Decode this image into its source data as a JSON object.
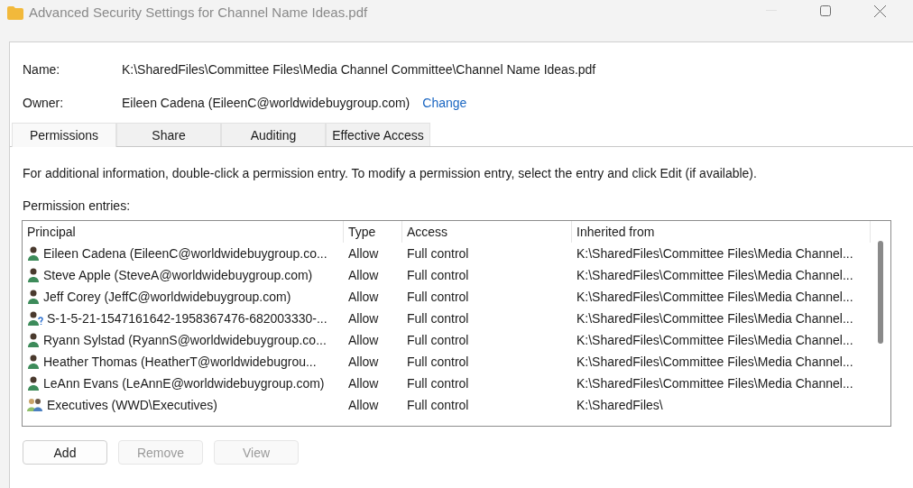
{
  "window": {
    "title": "Advanced Security Settings for Channel Name Ideas.pdf"
  },
  "fields": [
    {
      "label": "Name:",
      "value": "K:\\SharedFiles\\Committee Files\\Media Channel Committee\\Channel Name Ideas.pdf"
    },
    {
      "label": "Owner:",
      "value": "Eileen Cadena (EileenC@worldwidebuygroup.com)",
      "link": "Change"
    }
  ],
  "tabs": [
    {
      "label": "Permissions",
      "selected": true
    },
    {
      "label": "Share",
      "selected": false
    },
    {
      "label": "Auditing",
      "selected": false
    },
    {
      "label": "Effective Access",
      "selected": false
    }
  ],
  "info": "For additional information, double-click a permission entry. To modify a permission entry, select the entry and click Edit (if available).",
  "entries_label": "Permission entries:",
  "table": {
    "columns": [
      "Principal",
      "Type",
      "Access",
      "Inherited from"
    ],
    "rows": [
      {
        "kind": "user",
        "principal": "Eileen Cadena (EileenC@worldwidebuygroup.co...",
        "type": "Allow",
        "access": "Full control",
        "inherited": "K:\\SharedFiles\\Committee Files\\Media Channel..."
      },
      {
        "kind": "user",
        "principal": "Steve Apple (SteveA@worldwidebuygroup.com)",
        "type": "Allow",
        "access": "Full control",
        "inherited": "K:\\SharedFiles\\Committee Files\\Media Channel..."
      },
      {
        "kind": "user",
        "principal": "Jeff Corey (JeffC@worldwidebuygroup.com)",
        "type": "Allow",
        "access": "Full control",
        "inherited": "K:\\SharedFiles\\Committee Files\\Media Channel..."
      },
      {
        "kind": "unknown",
        "principal": "S-1-5-21-1547161642-1958367476-682003330-...",
        "type": "Allow",
        "access": "Full control",
        "inherited": "K:\\SharedFiles\\Committee Files\\Media Channel..."
      },
      {
        "kind": "user",
        "principal": "Ryann Sylstad (RyannS@worldwidebuygroup.co...",
        "type": "Allow",
        "access": "Full control",
        "inherited": "K:\\SharedFiles\\Committee Files\\Media Channel..."
      },
      {
        "kind": "user",
        "principal": "Heather Thomas (HeatherT@worldwidebugrou...",
        "type": "Allow",
        "access": "Full control",
        "inherited": "K:\\SharedFiles\\Committee Files\\Media Channel..."
      },
      {
        "kind": "user",
        "principal": "LeAnn Evans (LeAnnE@worldwidebuygroup.com)",
        "type": "Allow",
        "access": "Full control",
        "inherited": "K:\\SharedFiles\\Committee Files\\Media Channel..."
      },
      {
        "kind": "group",
        "principal": "Executives (WWD\\Executives)",
        "type": "Allow",
        "access": "Full control",
        "inherited": "K:\\SharedFiles\\"
      }
    ]
  },
  "buttons": [
    {
      "label": "Add",
      "disabled": false
    },
    {
      "label": "Remove",
      "disabled": true
    },
    {
      "label": "View",
      "disabled": true
    }
  ]
}
